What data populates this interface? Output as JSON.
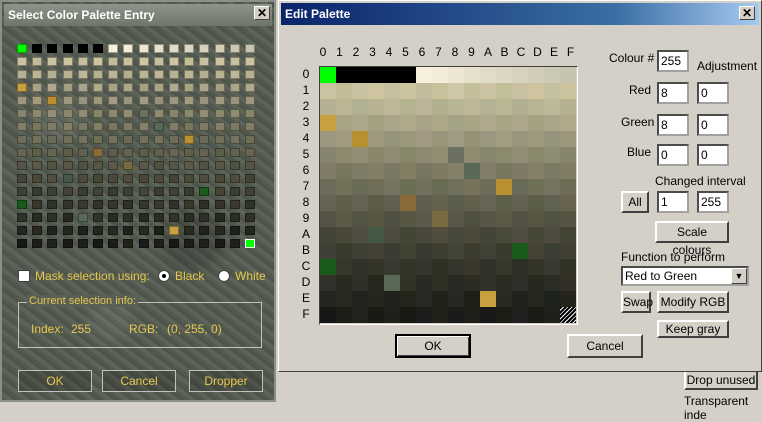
{
  "select_window": {
    "title": "Select Color Palette Entry",
    "close_glyph": "✕",
    "mask_label": "Mask selection using:",
    "mask_options": [
      "Black",
      "White"
    ],
    "selected_mask": "Black",
    "info_legend": "Current selection info:",
    "index_label": "Index:",
    "index_value": "255",
    "rgb_label": "RGB:",
    "rgb_value": "(0, 255, 0)",
    "ok": "OK",
    "cancel": "Cancel",
    "dropper": "Dropper"
  },
  "edit_window": {
    "title": "Edit Palette",
    "close_glyph": "✕",
    "hex_columns": [
      "0",
      "1",
      "2",
      "3",
      "4",
      "5",
      "6",
      "7",
      "8",
      "9",
      "A",
      "B",
      "C",
      "D",
      "E",
      "F"
    ],
    "hex_rows": [
      "0",
      "1",
      "2",
      "3",
      "4",
      "5",
      "6",
      "7",
      "8",
      "9",
      "A",
      "B",
      "C",
      "D",
      "E",
      "F"
    ],
    "colour_label": "Colour #",
    "colour_value": "255",
    "adjustment_label": "Adjustment",
    "red_label": "Red",
    "red_value": "8",
    "red_adj": "0",
    "green_label": "Green",
    "green_value": "8",
    "green_adj": "0",
    "blue_label": "Blue",
    "blue_value": "0",
    "blue_adj": "0",
    "changed_interval_label": "Changed interval",
    "all_button": "All",
    "interval_from": "1",
    "interval_to": "255",
    "scale_button": "Scale colours",
    "function_label": "Function to perform",
    "function_value": "Red to Green",
    "swap_button": "Swap",
    "modify_button": "Modify RGB",
    "keep_gray_button": "Keep gray",
    "ok": "OK",
    "cancel": "Cancel"
  },
  "background_app": {
    "drop_unused": "Drop unused",
    "transparent_index": "Transparent inde"
  },
  "palette": {
    "selected_index": 255,
    "selected_color": "#00ff00",
    "row0": [
      "#00ff00",
      "#000000",
      "#000000",
      "#000000",
      "#000000",
      "#000000",
      "#f7f0dc",
      "#f2ecd8",
      "#ece6d2",
      "#e6e1cd",
      "#e1dcc8",
      "#dbd7c3",
      "#d6d2be",
      "#d1cdb9",
      "#cbc8b4",
      "#c6c3af"
    ],
    "row_tints": [
      "#d8d0b0",
      "#c8c0a0",
      "#b8b296",
      "#aaa48a",
      "#9c9680",
      "#8c8872",
      "#7e7a66",
      "#706e5c",
      "#626050",
      "#565446",
      "#4a483c",
      "#3e3e34",
      "#34342c",
      "#2c2c26",
      "#242420",
      "#1c1c1a"
    ],
    "accents": [
      "#c8a040",
      "#b89030",
      "#6c7060",
      "#5a6858",
      "#8a6a3a",
      "#445a44",
      "#1a5a1a",
      "#7a6a40"
    ],
    "accent_map": [
      [
        3,
        0,
        0
      ],
      [
        4,
        1,
        2
      ],
      [
        5,
        2,
        8
      ],
      [
        6,
        3,
        9
      ],
      [
        7,
        1,
        11
      ],
      [
        8,
        4,
        5
      ],
      [
        10,
        5,
        3
      ],
      [
        11,
        6,
        12
      ],
      [
        12,
        6,
        0
      ],
      [
        9,
        7,
        7
      ],
      [
        13,
        3,
        4
      ],
      [
        14,
        0,
        10
      ]
    ]
  }
}
